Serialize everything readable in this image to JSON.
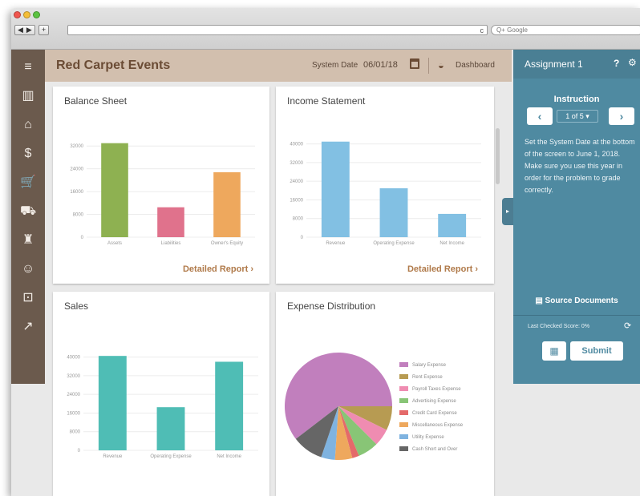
{
  "browser": {
    "reload_glyph": "c",
    "search_placeholder": "Q+ Google",
    "back_glyph": "◀",
    "forward_glyph": "▶",
    "newtab_glyph": "+"
  },
  "sidenav": {
    "items": [
      {
        "icon": "menu-icon",
        "glyph": "≡"
      },
      {
        "icon": "buildings-icon",
        "glyph": "▥"
      },
      {
        "icon": "bank-icon",
        "glyph": "⌂"
      },
      {
        "icon": "cash-register-icon",
        "glyph": "$"
      },
      {
        "icon": "cart-icon",
        "glyph": "🛒"
      },
      {
        "icon": "truck-icon",
        "glyph": "⛟"
      },
      {
        "icon": "hand-truck-icon",
        "glyph": "♜"
      },
      {
        "icon": "payroll-icon",
        "glyph": "☺"
      },
      {
        "icon": "safe-icon",
        "glyph": "⊡"
      },
      {
        "icon": "report-chart-icon",
        "glyph": "↗"
      }
    ]
  },
  "header": {
    "title": "Red Carpet Events",
    "system_date_label": "System Date",
    "system_date_value": "06/01/18",
    "dashboard_label": "Dashboard"
  },
  "cards": {
    "balance_sheet": {
      "title": "Balance Sheet",
      "link": "Detailed Report ›"
    },
    "income_statement": {
      "title": "Income Statement",
      "link": "Detailed Report ›"
    },
    "sales": {
      "title": "Sales"
    },
    "expense_distribution": {
      "title": "Expense Distribution"
    }
  },
  "right_panel": {
    "title": "Assignment 1",
    "help": "?",
    "gear": "⚙",
    "instruction_heading": "Instruction",
    "prev": "‹",
    "next": "›",
    "page_select": "1 of 5 ▾",
    "instruction_text": "Set the System Date at the bottom of the screen to June 1, 2018. Make sure you use this year in order for the problem to grade correctly.",
    "source_documents": "Source Documents",
    "last_checked": "Last Checked Score: 0%",
    "refresh": "⟳",
    "calculator": "▦",
    "submit": "Submit"
  },
  "colors": {
    "sidenav": "#6b5a4d",
    "header": "#d2bfae",
    "panel": "#4f8aa1",
    "link": "#b07a4a"
  },
  "chart_data": [
    {
      "type": "bar",
      "title": "Balance Sheet",
      "categories": [
        "Assets",
        "Liabilities",
        "Owner's Equity"
      ],
      "values": [
        33000,
        10500,
        22800
      ],
      "colors": [
        "#8eb151",
        "#e0728c",
        "#eea85d"
      ],
      "yticks": [
        0,
        8000,
        16000,
        24000,
        32000
      ],
      "ylim": [
        0,
        36000
      ]
    },
    {
      "type": "bar",
      "title": "Income Statement",
      "categories": [
        "Revenue",
        "Operating Expense",
        "Net Income"
      ],
      "values": [
        41000,
        21000,
        10000
      ],
      "colors": [
        "#82c0e3",
        "#82c0e3",
        "#82c0e3"
      ],
      "yticks": [
        0,
        8000,
        16000,
        24000,
        32000,
        40000
      ],
      "ylim": [
        0,
        44000
      ]
    },
    {
      "type": "bar",
      "title": "Sales",
      "categories": [
        "Revenue",
        "Operating Expense",
        "Net Income"
      ],
      "values": [
        40500,
        18500,
        38000
      ],
      "colors": [
        "#4fbdb5",
        "#4fbdb5",
        "#4fbdb5"
      ],
      "yticks": [
        0,
        8000,
        16000,
        24000,
        32000,
        40000
      ],
      "ylim": [
        0,
        44000
      ]
    },
    {
      "type": "pie",
      "title": "Expense Distribution",
      "labels": [
        "Salary Expense",
        "Rent Expense",
        "Payroll Taxes Expense",
        "Advertising Expense",
        "Credit Card Expense",
        "Miscellaneous Expense",
        "Utility Expense",
        "Cash Short and Over"
      ],
      "values": [
        58,
        7,
        5,
        6,
        2,
        5,
        4,
        9
      ],
      "colors": [
        "#c17fbd",
        "#b79b52",
        "#ef8cb1",
        "#88c576",
        "#e46a6a",
        "#eea85d",
        "#7fb3e0",
        "#666666"
      ]
    }
  ]
}
